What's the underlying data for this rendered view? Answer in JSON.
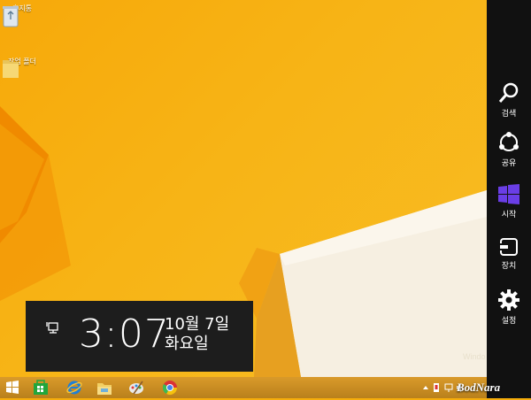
{
  "desktop": {
    "icons": [
      {
        "label": "휴지통",
        "icon": "recycle-bin-icon"
      },
      {
        "label": "작업 폴더",
        "icon": "folder-icon"
      }
    ],
    "watermark": "Windo"
  },
  "charms": [
    {
      "label": "검색",
      "icon": "search-icon"
    },
    {
      "label": "공유",
      "icon": "share-icon"
    },
    {
      "label": "시작",
      "icon": "windows-logo-icon",
      "color": "#6a3ee6"
    },
    {
      "label": "장치",
      "icon": "devices-icon"
    },
    {
      "label": "설정",
      "icon": "gear-icon"
    }
  ],
  "clock": {
    "time": "3:07",
    "date": "10월 7일",
    "weekday": "화요일"
  },
  "taskbar": {
    "buttons": [
      "start-button",
      "store-button",
      "ie-button",
      "explorer-button",
      "paint-button",
      "chrome-button"
    ],
    "brand": "BodNara"
  },
  "colors": {
    "charm_bar": "#111111",
    "accent": "#6a3ee6",
    "desktop": "#f7b416"
  }
}
